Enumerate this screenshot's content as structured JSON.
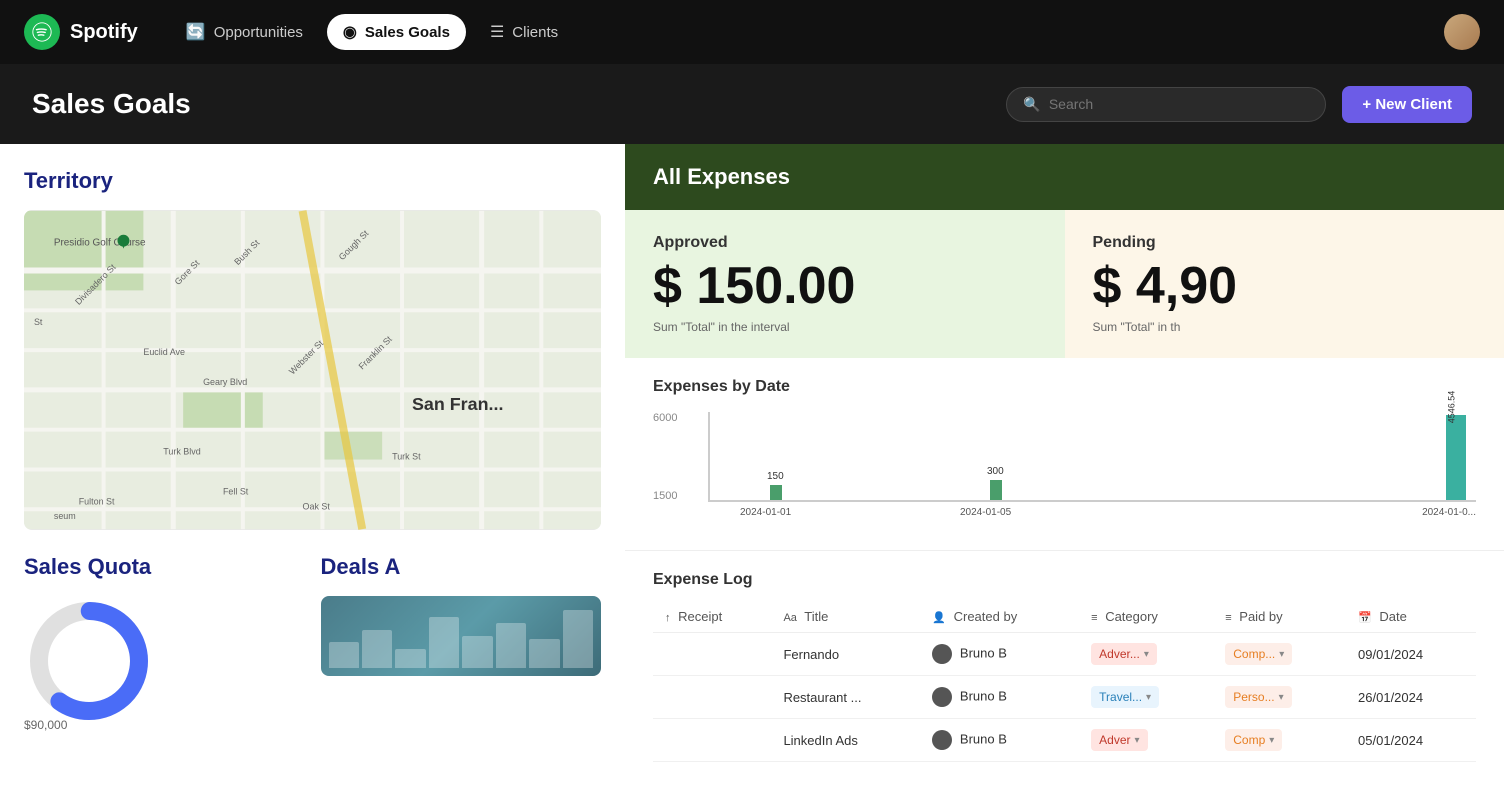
{
  "nav": {
    "logo_text": "Spotify",
    "items": [
      {
        "id": "opportunities",
        "label": "Opportunities",
        "icon": "🔄",
        "active": false
      },
      {
        "id": "sales-goals",
        "label": "Sales Goals",
        "icon": "◉",
        "active": true
      },
      {
        "id": "clients",
        "label": "Clients",
        "icon": "☰",
        "active": false
      }
    ]
  },
  "header": {
    "title": "Sales Goals",
    "search_placeholder": "Search",
    "new_client_label": "+ New Client"
  },
  "left": {
    "territory_title": "Territory",
    "sales_quota_title": "Sales Quota",
    "sales_quota_value": "$90,000",
    "deals_title": "Deals A"
  },
  "expenses": {
    "panel_title": "All Expenses",
    "approved": {
      "label": "Approved",
      "value": "$ 150.00",
      "subtitle": "Sum \"Total\" in the interval"
    },
    "pending": {
      "label": "Pending",
      "value": "$ 4,90",
      "subtitle": "Sum \"Total\" in th"
    },
    "chart": {
      "title": "Expenses by Date",
      "y_labels": [
        "6000",
        "1500"
      ],
      "bars": [
        {
          "date": "2024-01-01",
          "value": "150",
          "height": 15
        },
        {
          "date": "2024-01-05",
          "value": "300",
          "height": 20
        },
        {
          "date": "2024-01-0",
          "value": "4546.54",
          "height": 90
        }
      ]
    },
    "log": {
      "title": "Expense Log",
      "columns": [
        {
          "id": "receipt",
          "icon": "↑",
          "label": "Receipt"
        },
        {
          "id": "title",
          "icon": "Aa",
          "label": "Title"
        },
        {
          "id": "created_by",
          "icon": "👤",
          "label": "Created by"
        },
        {
          "id": "category",
          "icon": "≡",
          "label": "Category"
        },
        {
          "id": "paid_by",
          "icon": "≡",
          "label": "Paid by"
        },
        {
          "id": "date",
          "icon": "📅",
          "label": "Date"
        }
      ],
      "rows": [
        {
          "receipt": "",
          "title": "Fernando",
          "created_by": "Bruno B",
          "category": "Adver...",
          "category_type": "adver",
          "paid_by": "Comp...",
          "paid_by_type": "comp",
          "date": "09/01/2024"
        },
        {
          "receipt": "",
          "title": "Restaurant ...",
          "created_by": "Bruno B",
          "category": "Travel...",
          "category_type": "travel",
          "paid_by": "Perso...",
          "paid_by_type": "perso",
          "date": "26/01/2024"
        },
        {
          "receipt": "",
          "title": "LinkedIn Ads",
          "created_by": "Bruno B",
          "category": "Adver",
          "category_type": "adver",
          "paid_by": "Comp",
          "paid_by_type": "comp",
          "date": "05/01/2024"
        }
      ]
    }
  }
}
